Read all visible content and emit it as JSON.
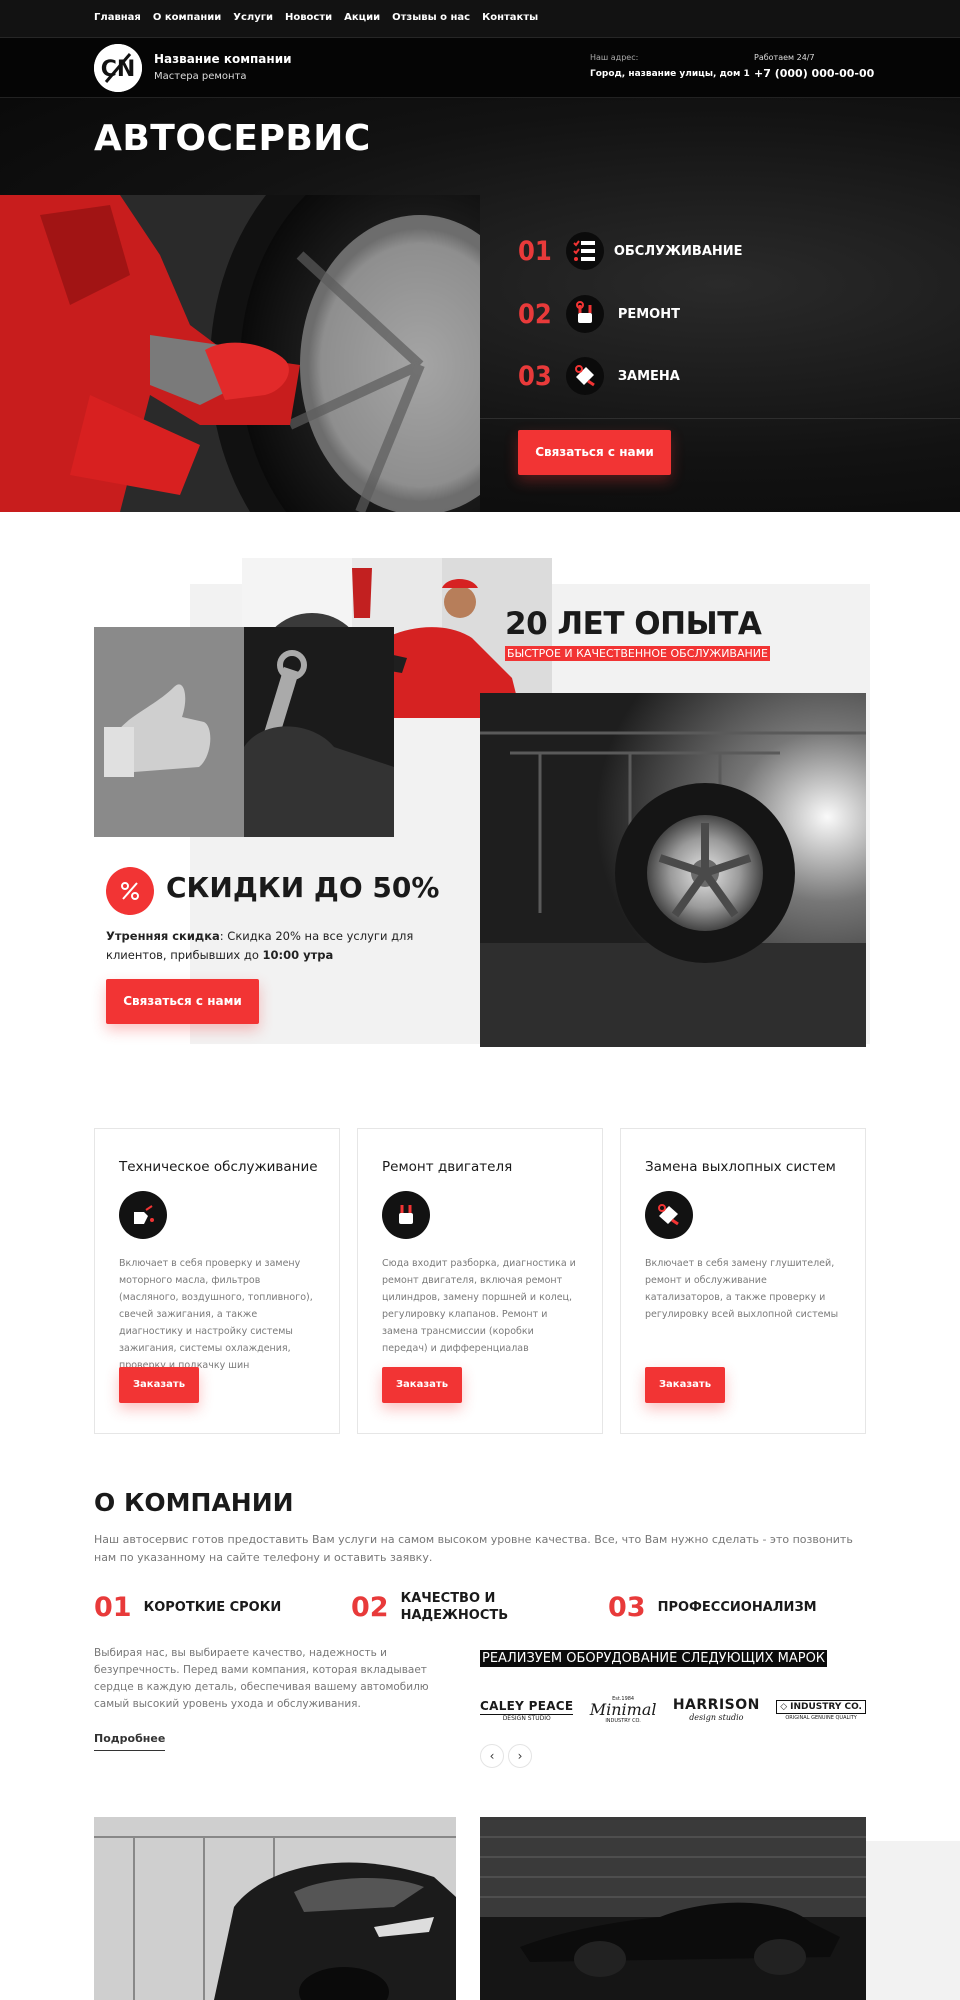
{
  "nav": {
    "items": [
      "Главная",
      "О компании",
      "Услуги",
      "Новости",
      "Акции",
      "Отзывы о нас",
      "Контакты"
    ]
  },
  "header": {
    "company_name": "Название компании",
    "company_sub": "Мастера ремонта",
    "address_label": "Наш адрес:",
    "address_value": "Город, название улицы, дом 1",
    "hours_label": "Работаем 24/7",
    "phone": "+7 (000) 000-00-00"
  },
  "hero": {
    "title": "АВТОСЕРВИС",
    "services": [
      {
        "num": "01",
        "label": "ОБСЛУЖИВАНИЕ",
        "icon": "checklist-icon"
      },
      {
        "num": "02",
        "label": "РЕМОНТ",
        "icon": "wrench-icon"
      },
      {
        "num": "03",
        "label": "ЗАМЕНА",
        "icon": "replace-icon"
      }
    ],
    "cta": "Связаться с нами"
  },
  "experience": {
    "title": "20 ЛЕТ ОПЫТА",
    "subtitle": "БЫСТРОЕ И КАЧЕСТВЕННОЕ ОБСЛУЖИВАНИЕ"
  },
  "discount": {
    "title": "СКИДКИ ДО 50%",
    "bold_lead": "Утренняя скидка",
    "text": ": Скидка 20% на все услуги для клиентов, прибывших до ",
    "time": "10:00 утра",
    "cta": "Связаться с нами"
  },
  "cards": [
    {
      "title": "Техническое обслуживание",
      "text": "Включает в себя проверку и замену моторного масла, фильтров (масляного, воздушного, топливного), свечей зажигания, а также диагностику и настройку системы зажигания, системы охлаждения, проверку и подкачку шин",
      "button": "Заказать",
      "icon": "oil-can-icon"
    },
    {
      "title": "Ремонт двигателя",
      "text": "Сюда входит разборка, диагностика и ремонт двигателя, включая ремонт цилиндров, замену поршней и колец, регулировку клапанов. Ремонт и замена трансмиссии (коробки передач) и дифференциалав",
      "button": "Заказать",
      "icon": "engine-icon"
    },
    {
      "title": "Замена выхлопных систем",
      "text": "Включает в себя замену глушителей, ремонт и обслуживание катализаторов, а также проверку и регулировку всей выхлопной системы",
      "button": "Заказать",
      "icon": "exhaust-icon"
    }
  ],
  "about": {
    "title": "О КОМПАНИИ",
    "text": "Наш автосервис готов предоставить Вам услуги на самом высоком уровне качества. Все, что Вам нужно сделать - это позвонить нам по указанному на сайте телефону и оставить заявку.",
    "features": [
      {
        "num": "01",
        "label": "КОРОТКИЕ  СРОКИ"
      },
      {
        "num": "02",
        "label": "КАЧЕСТВО И НАДЕЖНОСТЬ"
      },
      {
        "num": "03",
        "label": "ПРОФЕССИОНАЛИЗМ"
      }
    ],
    "more_text": "Выбирая нас, вы выбираете качество, надежность и безупречность. Перед вами компания, которая вкладывает сердце в каждую деталь, обеспечивая вашему автомобилю самый высокий уровень ухода и обслуживания.",
    "more_link": "Подробнее",
    "brands_title": "РЕАЛИЗУЕМ ОБОРУДОВАНИЕ СЛЕДУЮЩИХ МАРОК",
    "brands": [
      {
        "name": "CALEY PEACE",
        "sub": "DESIGN STUDIO"
      },
      {
        "name": "Minimal",
        "top": "Est.1984",
        "sub": "INDUSTRY CO."
      },
      {
        "name": "HARRISON",
        "sub": "design studio"
      },
      {
        "name": "INDUSTRY CO.",
        "sub": "ORIGINAL GENUINE QUALITY"
      }
    ]
  },
  "colors": {
    "accent": "#f23434",
    "dark": "#0b0b0b"
  }
}
